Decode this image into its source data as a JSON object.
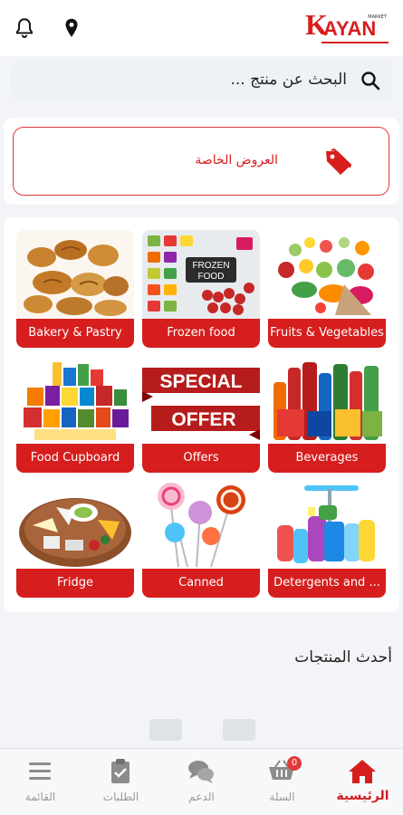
{
  "header": {
    "logo_letter": "K",
    "logo_text": "AYAN",
    "logo_mark": "MARKET",
    "icons": [
      "bell-icon",
      "location-pin-icon"
    ]
  },
  "search": {
    "placeholder": "البحث عن منتج ...",
    "icon": "search-icon"
  },
  "offers": {
    "label": "العروض الخاصة",
    "icon": "tag-icon"
  },
  "categories": [
    {
      "label": "Bakery & Pastry"
    },
    {
      "label": "Frozen food"
    },
    {
      "label": "Fruits & Vegetables"
    },
    {
      "label": "Food Cupboard"
    },
    {
      "label": "Offers"
    },
    {
      "label": "Beverages"
    },
    {
      "label": "Fridge"
    },
    {
      "label": "Canned"
    },
    {
      "label": "Detergents and ..."
    }
  ],
  "image_text": {
    "frozen_sign_1": "FROZEN",
    "frozen_sign_2": "FOOD",
    "special": "SPECIAL",
    "offer": "OFFER"
  },
  "latest": {
    "title": "أحدث المنتجات"
  },
  "nav": [
    {
      "label": "الرئيسية",
      "icon": "home-icon",
      "active": true
    },
    {
      "label": "السلة",
      "icon": "cart-icon",
      "badge": "0"
    },
    {
      "label": "الدعم",
      "icon": "chat-icon"
    },
    {
      "label": "الطلبات",
      "icon": "clipboard-check-icon"
    },
    {
      "label": "القائمة",
      "icon": "menu-icon"
    }
  ],
  "colors": {
    "brand": "#d61e1e",
    "background": "#f2f4f7",
    "inactive": "#999999"
  }
}
